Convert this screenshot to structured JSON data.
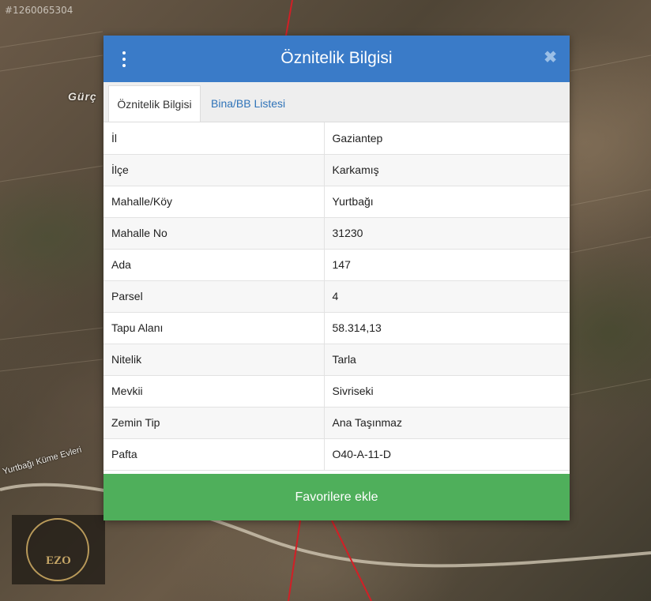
{
  "watermark_id": "#1260065304",
  "map_labels": {
    "top_left": "Gürç",
    "road": "Yurtbağı Küme Evleri"
  },
  "logo": {
    "text": "EZO"
  },
  "modal": {
    "title": "Öznitelik Bilgisi",
    "close_glyph": "✖",
    "tabs": [
      {
        "label": "Öznitelik Bilgisi",
        "active": true
      },
      {
        "label": "Bina/BB Listesi",
        "active": false
      }
    ],
    "rows": [
      {
        "key": "İl",
        "value": "Gaziantep"
      },
      {
        "key": "İlçe",
        "value": "Karkamış"
      },
      {
        "key": "Mahalle/Köy",
        "value": "Yurtbağı"
      },
      {
        "key": "Mahalle No",
        "value": "31230"
      },
      {
        "key": "Ada",
        "value": "147"
      },
      {
        "key": "Parsel",
        "value": "4"
      },
      {
        "key": "Tapu Alanı",
        "value": "58.314,13"
      },
      {
        "key": "Nitelik",
        "value": "Tarla"
      },
      {
        "key": "Mevkii",
        "value": "Sivriseki"
      },
      {
        "key": "Zemin Tip",
        "value": "Ana Taşınmaz"
      },
      {
        "key": "Pafta",
        "value": "O40-A-11-D"
      }
    ],
    "favorite_button": "Favorilere ekle"
  },
  "colors": {
    "header": "#3a7bc8",
    "favorite_button": "#4faf5b",
    "tab_link": "#2f73b8",
    "parcel_border": "#d21f26"
  }
}
